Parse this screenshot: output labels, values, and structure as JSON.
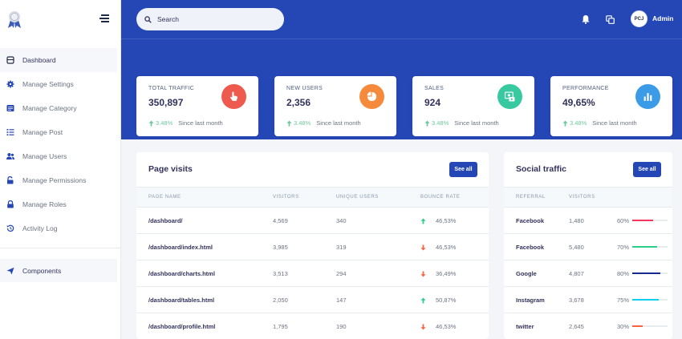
{
  "header": {
    "search_placeholder": "Search",
    "avatar_initials": "PCJ",
    "user_name": "Admin"
  },
  "sidebar": {
    "items": [
      {
        "label": "Dashboard",
        "icon": "dashboard-icon"
      },
      {
        "label": "Manage Settings",
        "icon": "gear-icon"
      },
      {
        "label": "Manage Category",
        "icon": "category-icon"
      },
      {
        "label": "Manage Post",
        "icon": "list-icon"
      },
      {
        "label": "Manage Users",
        "icon": "users-icon"
      },
      {
        "label": "Manage Permissions",
        "icon": "unlock-icon"
      },
      {
        "label": "Manage Roles",
        "icon": "lock-icon"
      },
      {
        "label": "Activity Log",
        "icon": "history-icon"
      }
    ],
    "components_label": "Components"
  },
  "stats": [
    {
      "title": "TOTAL TRAFFIC",
      "value": "350,897",
      "change": "3.48%",
      "since": "Since last month",
      "color": "#ef5a4e"
    },
    {
      "title": "NEW USERS",
      "value": "2,356",
      "change": "3.48%",
      "since": "Since last month",
      "color": "#f58a3c"
    },
    {
      "title": "SALES",
      "value": "924",
      "change": "3.48%",
      "since": "Since last month",
      "color": "#39c9a0"
    },
    {
      "title": "PERFORMANCE",
      "value": "49,65%",
      "change": "3.48%",
      "since": "Since last month",
      "color": "#3b9be6"
    }
  ],
  "page_visits": {
    "title": "Page visits",
    "see_all": "See all",
    "columns": [
      "PAGE NAME",
      "VISITORS",
      "UNIQUE USERS",
      "BOUNCE RATE"
    ],
    "rows": [
      {
        "page": "/dashboard/",
        "visitors": "4,569",
        "unique": "340",
        "bounce": "46,53%",
        "direction": "up"
      },
      {
        "page": "/dashboard/index.html",
        "visitors": "3,985",
        "unique": "319",
        "bounce": "46,53%",
        "direction": "down"
      },
      {
        "page": "/dashboard/charts.html",
        "visitors": "3,513",
        "unique": "294",
        "bounce": "36,49%",
        "direction": "down"
      },
      {
        "page": "/dashboard/tables.html",
        "visitors": "2,050",
        "unique": "147",
        "bounce": "50,87%",
        "direction": "up"
      },
      {
        "page": "/dashboard/profile.html",
        "visitors": "1,795",
        "unique": "190",
        "bounce": "46,53%",
        "direction": "down"
      }
    ]
  },
  "social_traffic": {
    "title": "Social traffic",
    "see_all": "See all",
    "columns": [
      "REFERRAL",
      "VISITORS"
    ],
    "rows": [
      {
        "referral": "Facebook",
        "visitors": "1,480",
        "percent": "60%",
        "fill": 0.6,
        "color": "#f5365c"
      },
      {
        "referral": "Facebook",
        "visitors": "5,480",
        "percent": "70%",
        "fill": 0.7,
        "color": "#2dce89"
      },
      {
        "referral": "Google",
        "visitors": "4,807",
        "percent": "80%",
        "fill": 0.8,
        "color": "#172b8d"
      },
      {
        "referral": "Instagram",
        "visitors": "3,678",
        "percent": "75%",
        "fill": 0.75,
        "color": "#11cdef"
      },
      {
        "referral": "twitter",
        "visitors": "2,645",
        "percent": "30%",
        "fill": 0.3,
        "color": "#fb6340"
      }
    ]
  }
}
